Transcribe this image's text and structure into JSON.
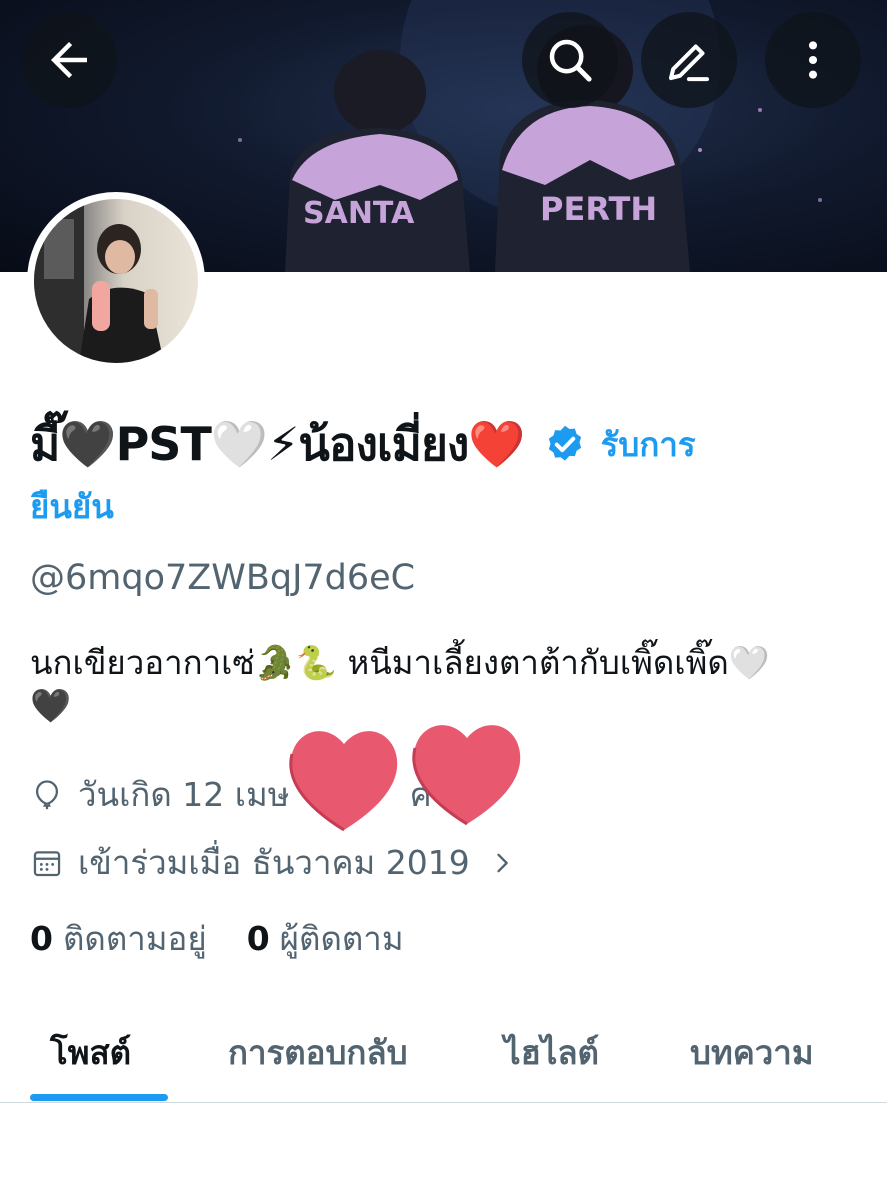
{
  "header": {
    "back_icon": "arrow-left-icon",
    "search_icon": "search-icon",
    "edit_icon": "pencil-icon",
    "more_icon": "more-vertical-icon",
    "banner_jacket_left": "SANTA",
    "banner_jacket_right": "PERTH"
  },
  "profile": {
    "display_name": "มี๊🖤PST🤍⚡น้องเมี่ยง❤️",
    "verify_label_part1": "รับการ",
    "verify_label_part2": "ยืนยัน",
    "handle": "@6mqo7ZWBqJ7d6eC",
    "bio_line1": "นกเขียวอากาเซ่🐊🐍 หนีมาเลี้ยงตาต้ากับเพิ๊ดเพิ๊ด🤍",
    "bio_line2": "🖤",
    "birthday": "วันเกิด 12 เมษ",
    "birthday_hidden_tail": "ค",
    "joined": "เข้าร่วมเมื่อ ธันวาคม 2019",
    "following_count": "0",
    "following_label": "ติดตามอยู่",
    "followers_count": "0",
    "followers_label": "ผู้ติดตาม"
  },
  "tabs": [
    {
      "label": "โพสต์",
      "active": true
    },
    {
      "label": "การตอบกลับ",
      "active": false
    },
    {
      "label": "ไฮไลต์",
      "active": false
    },
    {
      "label": "บทความ",
      "active": false
    }
  ],
  "colors": {
    "accent": "#1d9bf0",
    "secondary_text": "#536471",
    "primary_text": "#0f1419",
    "sticker_heart": "#e8586e"
  }
}
